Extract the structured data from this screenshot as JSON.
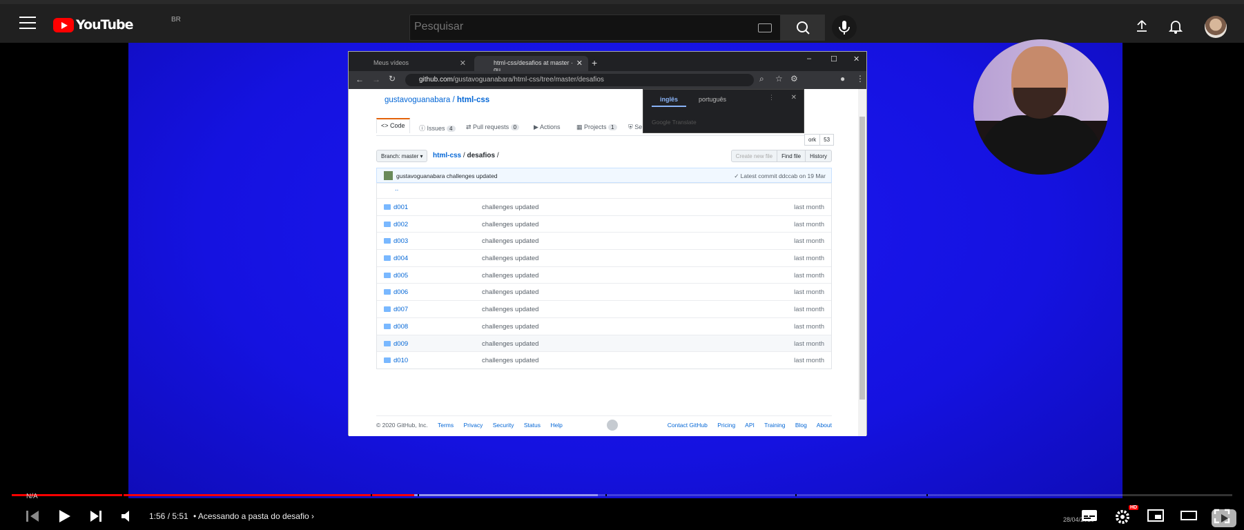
{
  "masthead": {
    "logo_text": "YouTube",
    "country_code": "BR",
    "search_placeholder": "Pesquisar"
  },
  "browser": {
    "tabs": [
      {
        "label": "Meus vídeos"
      },
      {
        "label": "html-css/desafios at master · gu"
      }
    ],
    "url_host": "github.com",
    "url_path": "/gustavoguanabara/html-css/tree/master/desafios"
  },
  "translate_popup": {
    "lang_from": "inglês",
    "lang_to": "português",
    "branding": "Google Translate"
  },
  "repo": {
    "owner": "gustavoguanabara",
    "name": "html-css",
    "fork_label": "ork",
    "fork_count": "53",
    "tabs": {
      "code": "Code",
      "issues": "Issues",
      "issues_count": "4",
      "pull_requests": "Pull requests",
      "pull_requests_count": "0",
      "actions": "Actions",
      "projects": "Projects",
      "projects_count": "1",
      "security": "Se"
    },
    "branch_label": "Branch: master ▾",
    "breadcrumb_repo": "html-css",
    "breadcrumb_sep": "/",
    "breadcrumb_folder": "desafios",
    "breadcrumb_tail": "/",
    "buttons": {
      "create_new_file": "Create new file",
      "find_file": "Find file",
      "history": "History"
    },
    "commit": {
      "author": "gustavoguanabara",
      "message": "challenges updated",
      "latest": "✓ Latest commit ddccab on 19 Mar"
    },
    "parent_dir": "..",
    "files": [
      {
        "name": "d001",
        "message": "challenges updated",
        "age": "last month"
      },
      {
        "name": "d002",
        "message": "challenges updated",
        "age": "last month"
      },
      {
        "name": "d003",
        "message": "challenges updated",
        "age": "last month"
      },
      {
        "name": "d004",
        "message": "challenges updated",
        "age": "last month"
      },
      {
        "name": "d005",
        "message": "challenges updated",
        "age": "last month"
      },
      {
        "name": "d006",
        "message": "challenges updated",
        "age": "last month"
      },
      {
        "name": "d007",
        "message": "challenges updated",
        "age": "last month"
      },
      {
        "name": "d008",
        "message": "challenges updated",
        "age": "last month"
      },
      {
        "name": "d009",
        "message": "challenges updated",
        "age": "last month"
      },
      {
        "name": "d010",
        "message": "challenges updated",
        "age": "last month"
      }
    ],
    "footer": {
      "copyright": "© 2020 GitHub, Inc.",
      "left_links": [
        "Terms",
        "Privacy",
        "Security",
        "Status",
        "Help"
      ],
      "right_links": [
        "Contact GitHub",
        "Pricing",
        "API",
        "Training",
        "Blog",
        "About"
      ]
    }
  },
  "player": {
    "na_label": "N/A",
    "current_time": "1:56",
    "duration": "5:51",
    "time_text": "1:56 / 5:51",
    "chapter": "Acessando a pasta do desafio",
    "played_fraction": 0.33,
    "loaded_fraction": 0.48,
    "hd_badge": "HD",
    "accent_color": "#ff0000"
  },
  "taskbar_date": "28/04/2020"
}
